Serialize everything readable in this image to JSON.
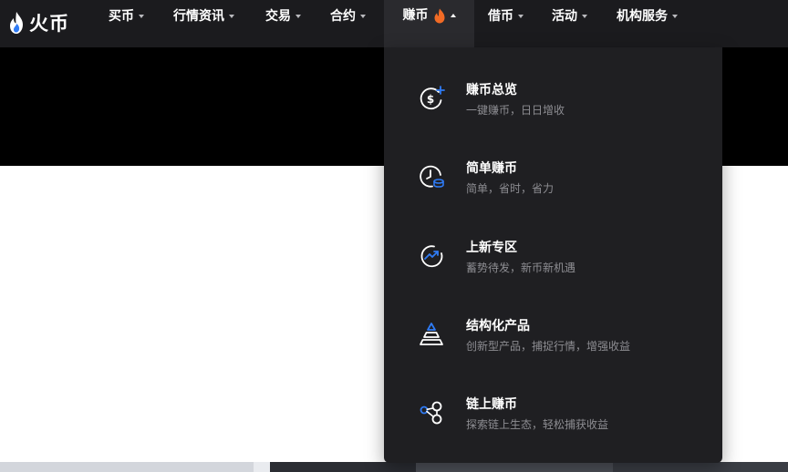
{
  "brand": {
    "name": "火币"
  },
  "nav": {
    "items": [
      {
        "label": "买币"
      },
      {
        "label": "行情资讯"
      },
      {
        "label": "交易"
      },
      {
        "label": "合约"
      },
      {
        "label": "赚币"
      },
      {
        "label": "借币"
      },
      {
        "label": "活动"
      },
      {
        "label": "机构服务"
      }
    ]
  },
  "dropdown": {
    "items": [
      {
        "title": "赚币总览",
        "subtitle": "一键赚币，日日增收",
        "icon": "dollar-plus-icon"
      },
      {
        "title": "简单赚币",
        "subtitle": "简单，省时，省力",
        "icon": "clock-coin-icon"
      },
      {
        "title": "上新专区",
        "subtitle": "蓄势待发，新币新机遇",
        "icon": "trend-up-icon"
      },
      {
        "title": "结构化产品",
        "subtitle": "创新型产品，捕捉行情，增强收益",
        "icon": "pyramid-icon"
      },
      {
        "title": "链上赚币",
        "subtitle": "探索链上生态，轻松捕获收益",
        "icon": "chain-nodes-icon"
      }
    ]
  },
  "colors": {
    "nav_bg": "#1b1b1e",
    "dropdown_bg": "#1f1f22",
    "accent_blue": "#2f7bf5",
    "flame": "#f26b25"
  }
}
